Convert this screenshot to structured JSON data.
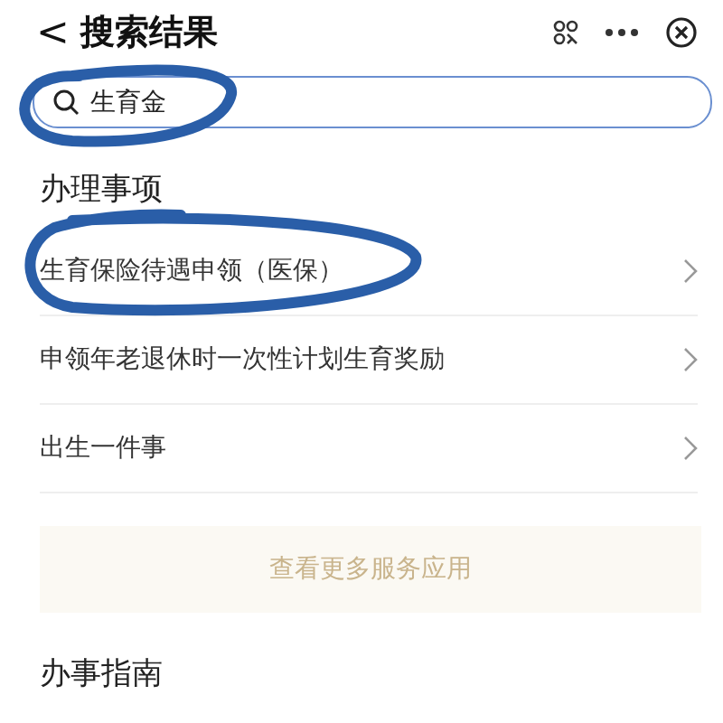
{
  "header": {
    "back": "<",
    "title": "搜索结果"
  },
  "search": {
    "value": "生育金"
  },
  "sections": [
    {
      "title": "办理事项",
      "items": [
        {
          "label": "生育保险待遇申领（医保）"
        },
        {
          "label": "申领年老退休时一次性计划生育奖励"
        },
        {
          "label": "出生一件事"
        }
      ],
      "more": "查看更多服务应用"
    },
    {
      "title": "办事指南"
    }
  ]
}
